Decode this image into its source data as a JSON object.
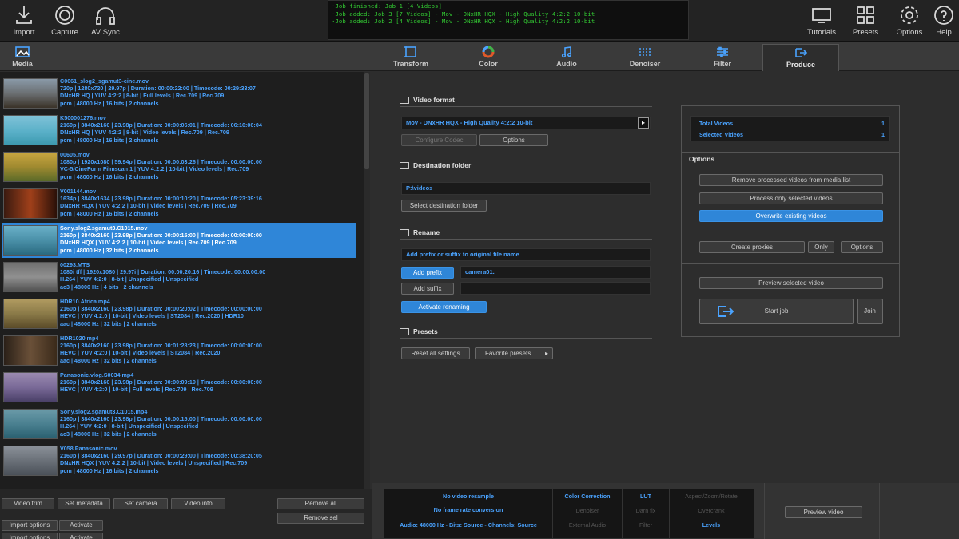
{
  "toolbar": {
    "import": "Import",
    "capture": "Capture",
    "avsync": "AV Sync",
    "tutorials": "Tutorials",
    "presets": "Presets",
    "options": "Options",
    "help": "Help"
  },
  "log": [
    "·Job finished: Job 1 [4 Videos]",
    "·Job added: Job 3 [7 Videos] -  Mov - DNxHR HQX - High Quality 4:2:2 10-bit",
    "·Job added: Job 2 [4 Videos] -  Mov - DNxHR HQX - High Quality 4:2:2 10-bit"
  ],
  "tabs": {
    "media": "Media",
    "transform": "Transform",
    "color": "Color",
    "audio": "Audio",
    "denoiser": "Denoiser",
    "filter": "Filter",
    "produce": "Produce"
  },
  "media_items": [
    {
      "l1": "C0061_slog2_sgamut3-cine.mov",
      "l2": "720p  |  1280x720  |  29.97p  |  Duration:  00:00:22:00  |  Timecode: 00:29:33:07",
      "l3": "DNxHR HQ  |  YUV 4:2:2  |  8-bit  |  Full levels  |  Rec.709  |  Rec.709",
      "l4": "pcm  |  48000 Hz  |  16 bits  |  2 channels"
    },
    {
      "l1": "K500001276.mov",
      "l2": "2160p  |  3840x2160  |  23.98p  |  Duration:  00:00:06:01  |  Timecode: 06:16:06:04",
      "l3": "DNxHR HQ  |  YUV 4:2:2  |  8-bit  |  Video levels  |  Rec.709  |  Rec.709",
      "l4": "pcm  |  48000 Hz  |  16 bits  |  2 channels"
    },
    {
      "l1": "00605.mov",
      "l2": "1080p  |  1920x1080  |  59.94p  |  Duration:  00:00:03:26  |  Timecode: 00:00:00:00",
      "l3": "VC-5/CineForm Filmscan 1  |  YUV 4:2:2  |  10-bit  |  Video levels  |  Rec.709",
      "l4": "pcm  |  48000 Hz  |  16 bits  |  2 channels"
    },
    {
      "l1": "V001144.mov",
      "l2": "1634p  |  3840x1634  |  23.98p  |  Duration:  00:00:10:20  |  Timecode: 05:23:39:16",
      "l3": "DNxHR HQX  |  YUV 4:2:2  |  10-bit  |  Video levels  |  Rec.709  |  Rec.709",
      "l4": "pcm  |  48000 Hz  |  16 bits  |  2 channels"
    },
    {
      "l1": "Sony.slog2.sgamut3.C1015.mov",
      "l2": "2160p  |  3840x2160  |  23.98p  |  Duration:  00:00:15:00  |  Timecode: 00:00:00:00",
      "l3": "DNxHR HQX  |  YUV 4:2:2  |  10-bit  |  Video levels  |  Rec.709  |  Rec.709",
      "l4": "pcm  |  48000 Hz  |  32 bits  |  2 channels"
    },
    {
      "l1": "00293.MTS",
      "l2": "1080i tff  |  1920x1080  |  29.97i  |  Duration:  00:00:20:16  |  Timecode: 00:00:00:00",
      "l3": "H.264  |  YUV 4:2:0  |  8-bit  |  Unspecified  |  Unspecified",
      "l4": "ac3  |  48000 Hz  |  4 bits  |  2 channels"
    },
    {
      "l1": "HDR10.Africa.mp4",
      "l2": "2160p  |  3840x2160  |  23.98p  |  Duration:  00:00:20:02  |  Timecode: 00:00:00:00",
      "l3": "HEVC  |  YUV 4:2:0  |  10-bit  |  Video levels  |  ST2084  |  Rec.2020  |  HDR10",
      "l4": "aac  |  48000 Hz  |  32 bits  |  2 channels"
    },
    {
      "l1": "HDR1020.mp4",
      "l2": "2160p  |  3840x2160  |  23.98p  |  Duration:  00:01:28:23  |  Timecode: 00:00:00:00",
      "l3": "HEVC  |  YUV 4:2:0  |  10-bit  |  Video levels  |  ST2084  |  Rec.2020",
      "l4": "aac  |  48000 Hz  |  32 bits  |  2 channels"
    },
    {
      "l1": "Panasonic.vlog.S0034.mp4",
      "l2": "2160p  |  3840x2160  |  23.98p  |  Duration:  00:00:09:19  |  Timecode: 00:00:00:00",
      "l3": "HEVC  |  YUV 4:2:0  |  10-bit  |  Full levels  |  Rec.709  |  Rec.709",
      "l4": ""
    },
    {
      "l1": "Sony.slog2.sgamut3.C1015.mp4",
      "l2": "2160p  |  3840x2160  |  23.98p  |  Duration:  00:00:15:00  |  Timecode: 00:00:00:00",
      "l3": "H.264  |  YUV 4:2:0  |  8-bit  |  Unspecified  |  Unspecified",
      "l4": "ac3  |  48000 Hz  |  32 bits  |  2 channels"
    },
    {
      "l1": "V058.Panasonic.mov",
      "l2": "2160p  |  3840x2160  |  29.97p  |  Duration:  00:00:29:00  |  Timecode: 00:38:20:05",
      "l3": "DNxHR HQX  |  YUV 4:2:2  |  10-bit  |  Video levels  |  Unspecified  |  Rec.709",
      "l4": "pcm  |  48000 Hz  |  16 bits  |  2 channels"
    }
  ],
  "media_buttons": {
    "video_trim": "Video trim",
    "set_metadata": "Set metadata",
    "set_camera": "Set camera",
    "video_info": "Video info",
    "remove_all": "Remove all",
    "remove_sel": "Remove sel",
    "import_options": "Import options",
    "activate": "Activate",
    "import_options2": "Import options",
    "activate2": "Activate"
  },
  "produce": {
    "video_format_title": "Video format",
    "video_format_value": "Mov - DNxHR HQX - High Quality 4:2:2 10-bit",
    "configure_codec": "Configure Codec",
    "options": "Options",
    "dest_title": "Destination folder",
    "dest_value": "P:\\videos",
    "select_dest": "Select destination folder",
    "rename_title": "Rename",
    "rename_hint": "Add prefix or suffix to original file name",
    "add_prefix": "Add prefix",
    "prefix_value": "camera01.",
    "add_suffix": "Add suffix",
    "activate_renaming": "Activate renaming",
    "presets_title": "Presets",
    "reset_all": "Reset all settings",
    "favorite_presets": "Favorite presets"
  },
  "stats": {
    "total_label": "Total Videos",
    "total_value": "1",
    "selected_label": "Selected Videos",
    "selected_value": "1"
  },
  "options_panel": {
    "title": "Options",
    "remove_processed": "Remove processed videos from media list",
    "process_selected": "Process only selected videos",
    "overwrite": "Overwrite existing videos",
    "create_proxies": "Create proxies",
    "only": "Only",
    "options": "Options",
    "preview_selected": "Preview selected video",
    "start_job": "Start job",
    "join": "Join"
  },
  "summary": {
    "no_resample": "No video resample",
    "no_framerate": "No frame rate conversion",
    "audio": "Audio: 48000 Hz - Bits: Source - Channels: Source",
    "color_correction": "Color Correction",
    "lut": "LUT",
    "aspect": "Aspect/Zoom/Rotate",
    "denoiser": "Denoiser",
    "darn_fix": "Darn fix",
    "overcrank": "Overcrank",
    "external_audio": "External Audio",
    "filter": "Filter",
    "levels": "Levels",
    "preview_video": "Preview video"
  }
}
